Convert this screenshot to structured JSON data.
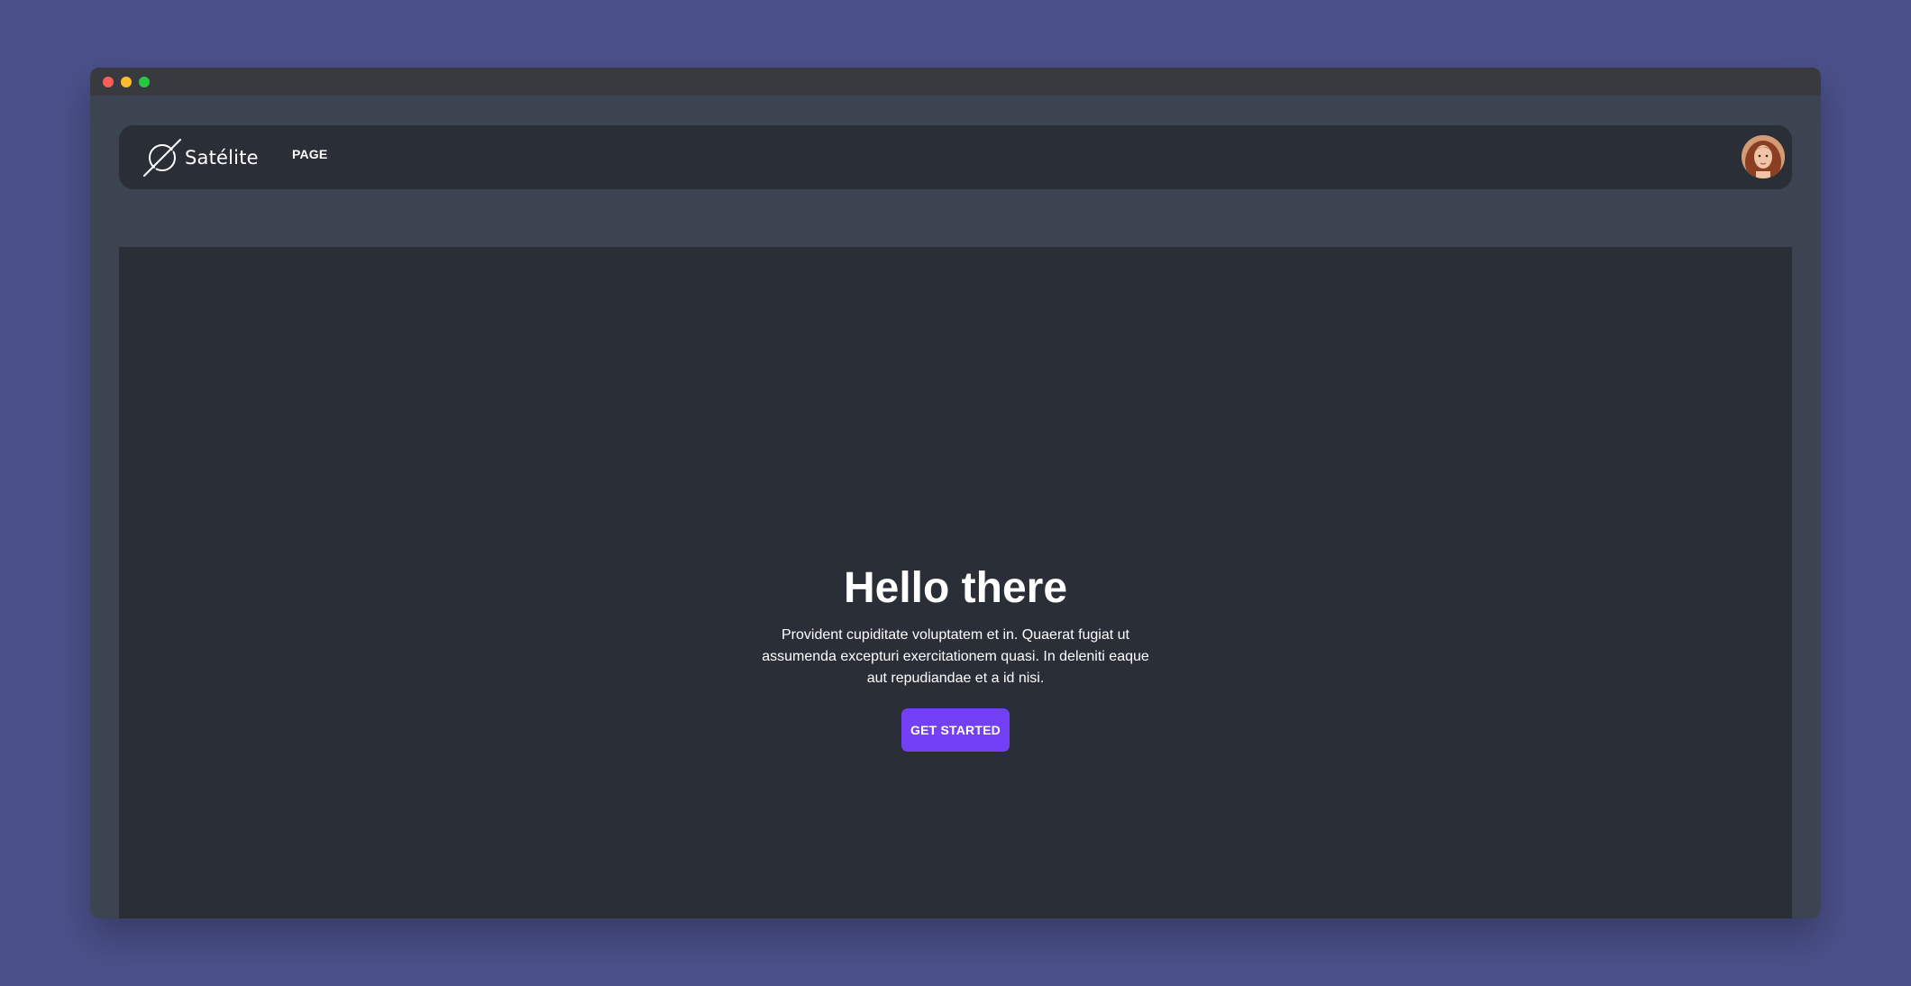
{
  "window": {
    "controls": [
      "close",
      "minimize",
      "maximize"
    ]
  },
  "navbar": {
    "brand": "Satélite",
    "brand_icon": "planet-logo-icon",
    "links": [
      {
        "label": "PAGE"
      }
    ],
    "avatar": "user-avatar"
  },
  "hero": {
    "title": "Hello there",
    "description": "Provident cupiditate voluptatem et in. Quaerat fugiat ut assumenda excepturi exercitationem quasi. In deleniti eaque aut repudiandae et a id nisi.",
    "cta_label": "GET STARTED"
  },
  "colors": {
    "background": "#4a5089",
    "window": "#3d4451",
    "panel": "#2a2e37",
    "accent": "#7340f5"
  }
}
